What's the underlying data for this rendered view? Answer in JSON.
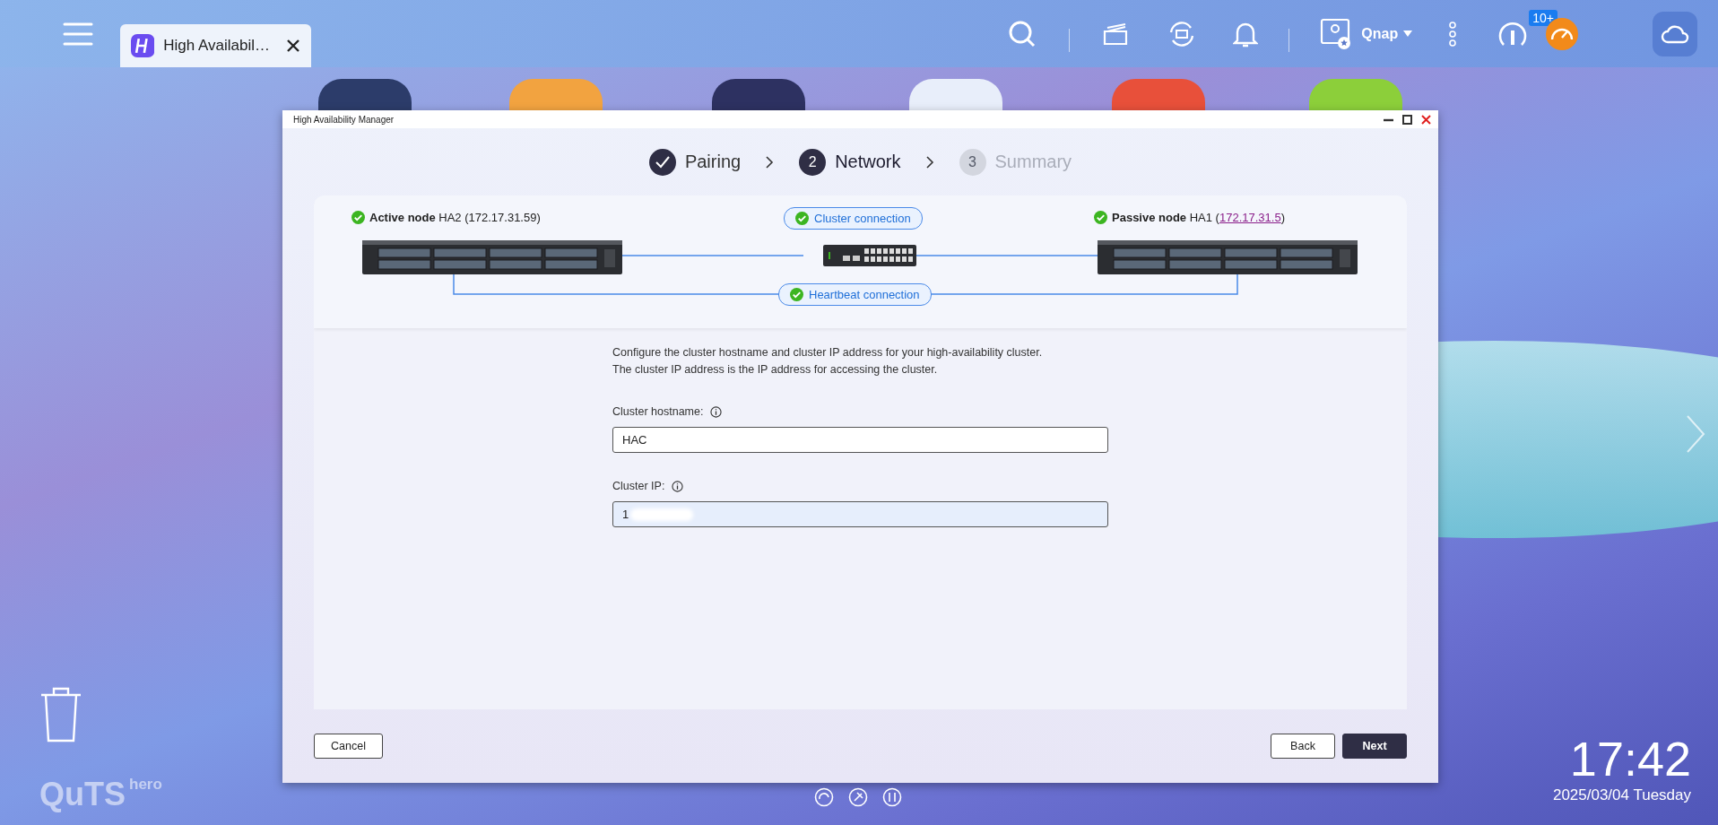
{
  "taskbar": {
    "tab": {
      "title": "High Availabil…"
    },
    "user": "Qnap",
    "badge": "10+"
  },
  "window": {
    "title": "High Availability Manager",
    "steps": [
      {
        "label": "Pairing",
        "done": true,
        "selected": false
      },
      {
        "number": "2",
        "label": "Network",
        "done": false,
        "selected": true
      },
      {
        "number": "3",
        "label": "Summary",
        "done": false,
        "selected": false
      }
    ],
    "diagram": {
      "active_node": "**Active node** HA2 (172.17.31.59)",
      "passive_node": {
        "prefix": "**Passive node** HA1 (",
        "link": "172.17.31.5",
        "suffix": ")"
      },
      "cluster_connection": "Cluster connection",
      "heartbeat_connection": "Heartbeat connection"
    },
    "description": [
      "Configure the cluster hostname and cluster IP address for your high-availability cluster.",
      "The cluster IP address is the IP address for accessing the cluster."
    ],
    "fields": [
      {
        "label": "Cluster hostname:",
        "value": "HAC",
        "focused": false,
        "redacted": false
      },
      {
        "label": "Cluster IP:",
        "value": "1",
        "focused": true,
        "redacted": true
      }
    ],
    "buttons": [
      {
        "label": "Cancel",
        "kind": "secondary"
      },
      {
        "label": "Back",
        "kind": "secondary"
      },
      {
        "label": "Next",
        "kind": "primary"
      }
    ]
  },
  "desktop": {
    "logo": "QuTS",
    "logo_suffix": "hero",
    "time": "17:42",
    "date": "2025/03/04 Tuesday"
  }
}
